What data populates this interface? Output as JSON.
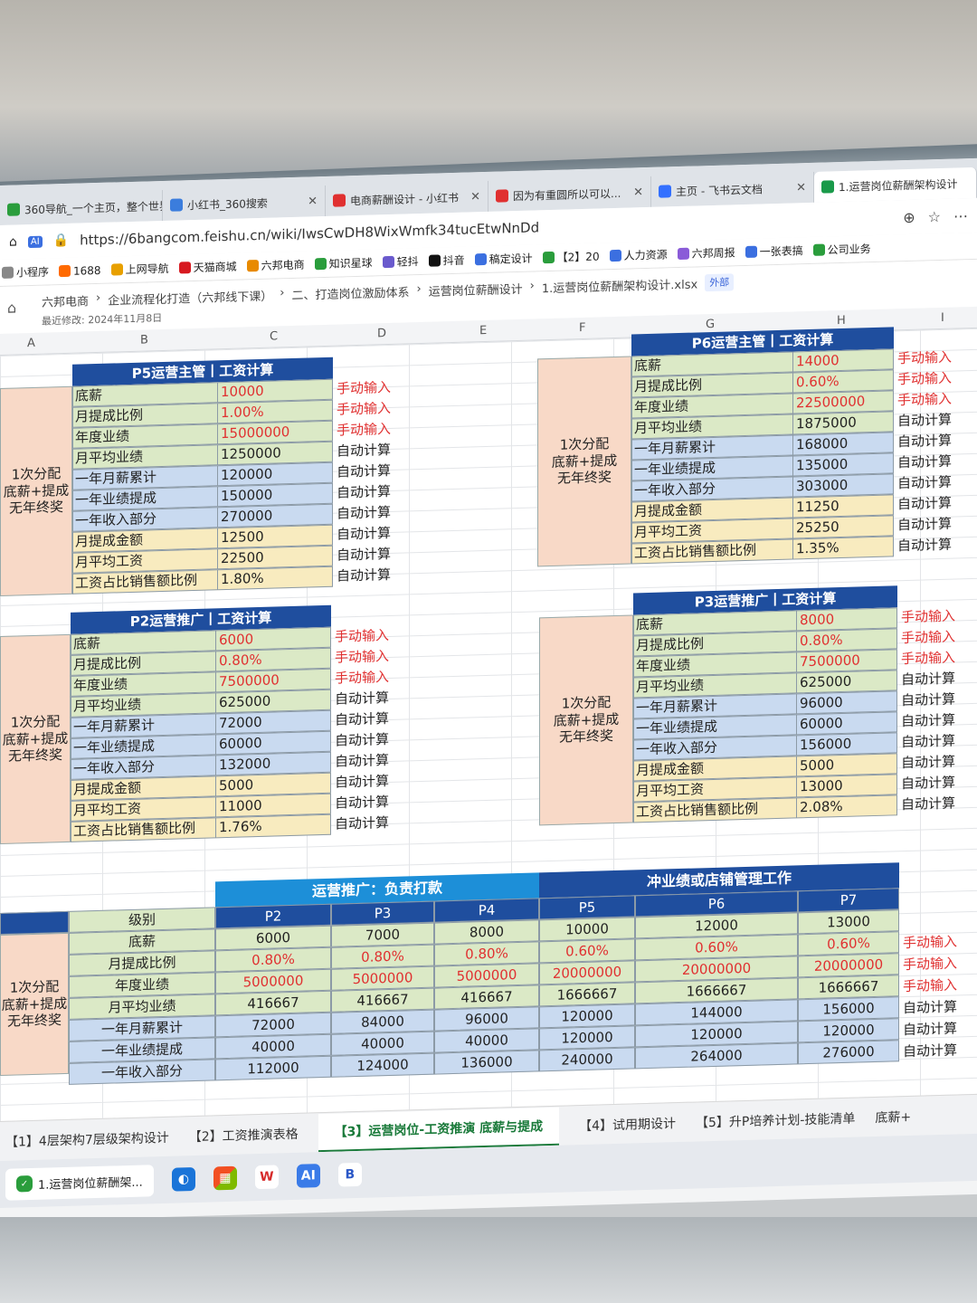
{
  "browser": {
    "tabs": [
      {
        "label": "360导航_一个主页，整个世界",
        "color": "#2a9d3c"
      },
      {
        "label": "小红书_360搜索",
        "color": "#3b7ddd"
      },
      {
        "label": "电商薪酬设计 - 小红书",
        "color": "#e03030"
      },
      {
        "label": "因为有重圆所以可以...",
        "color": "#e03030"
      },
      {
        "label": "主页 - 飞书云文档",
        "color": "#3370ff"
      },
      {
        "label": "1.运营岗位薪酬架构设计",
        "color": "#1a9a4a"
      }
    ],
    "url": "https://6bangcom.feishu.cn/wiki/IwsCwDH8WixWmfk34tucEtwNnDd",
    "bookmarks": [
      "小程序",
      "1688",
      "上网导航",
      "天猫商城",
      "六邦电商",
      "知识星球",
      "轻抖",
      "抖音",
      "稿定设计",
      "【2】20",
      "人力资源",
      "六邦周报",
      "一张表搞",
      "公司业务"
    ]
  },
  "breadcrumb": {
    "items": [
      "六邦电商",
      "企业流程化打造（六邦线下课）",
      "二、打造岗位激励体系",
      "运营岗位薪酬设计",
      "1.运营岗位薪酬架构设计.xlsx"
    ],
    "external": "外部",
    "modified": "最近修改: 2024年11月8日"
  },
  "columns": [
    "A",
    "B",
    "C",
    "D",
    "E",
    "F",
    "G",
    "H",
    "I"
  ],
  "side_label": "1次分配\n底薪+提成\n无年终奖",
  "blocks": {
    "p5": {
      "title": "P5运营主管丨工资计算",
      "rows": [
        {
          "label": "底薪",
          "value": "10000",
          "note": "手动输入"
        },
        {
          "label": "月提成比例",
          "value": "1.00%",
          "note": "手动输入"
        },
        {
          "label": "年度业绩",
          "value": "15000000",
          "note": "手动输入"
        },
        {
          "label": "月平均业绩",
          "value": "1250000",
          "note": "自动计算"
        },
        {
          "label": "一年月薪累计",
          "value": "120000",
          "note": "自动计算"
        },
        {
          "label": "一年业绩提成",
          "value": "150000",
          "note": "自动计算"
        },
        {
          "label": "一年收入部分",
          "value": "270000",
          "note": "自动计算"
        },
        {
          "label": "月提成金额",
          "value": "12500",
          "note": "自动计算"
        },
        {
          "label": "月平均工资",
          "value": "22500",
          "note": "自动计算"
        },
        {
          "label": "工资占比销售额比例",
          "value": "1.80%",
          "note": "自动计算"
        }
      ]
    },
    "p6": {
      "title": "P6运营主管丨工资计算",
      "rows": [
        {
          "label": "底薪",
          "value": "14000",
          "note": "手动输入"
        },
        {
          "label": "月提成比例",
          "value": "0.60%",
          "note": "手动输入"
        },
        {
          "label": "年度业绩",
          "value": "22500000",
          "note": "手动输入"
        },
        {
          "label": "月平均业绩",
          "value": "1875000",
          "note": "自动计算"
        },
        {
          "label": "一年月薪累计",
          "value": "168000",
          "note": "自动计算"
        },
        {
          "label": "一年业绩提成",
          "value": "135000",
          "note": "自动计算"
        },
        {
          "label": "一年收入部分",
          "value": "303000",
          "note": "自动计算"
        },
        {
          "label": "月提成金额",
          "value": "11250",
          "note": "自动计算"
        },
        {
          "label": "月平均工资",
          "value": "25250",
          "note": "自动计算"
        },
        {
          "label": "工资占比销售额比例",
          "value": "1.35%",
          "note": "自动计算"
        }
      ]
    },
    "p2": {
      "title": "P2运营推广丨工资计算",
      "rows": [
        {
          "label": "底薪",
          "value": "6000",
          "note": "手动输入"
        },
        {
          "label": "月提成比例",
          "value": "0.80%",
          "note": "手动输入"
        },
        {
          "label": "年度业绩",
          "value": "7500000",
          "note": "手动输入"
        },
        {
          "label": "月平均业绩",
          "value": "625000",
          "note": "自动计算"
        },
        {
          "label": "一年月薪累计",
          "value": "72000",
          "note": "自动计算"
        },
        {
          "label": "一年业绩提成",
          "value": "60000",
          "note": "自动计算"
        },
        {
          "label": "一年收入部分",
          "value": "132000",
          "note": "自动计算"
        },
        {
          "label": "月提成金额",
          "value": "5000",
          "note": "自动计算"
        },
        {
          "label": "月平均工资",
          "value": "11000",
          "note": "自动计算"
        },
        {
          "label": "工资占比销售额比例",
          "value": "1.76%",
          "note": "自动计算"
        }
      ]
    },
    "p3": {
      "title": "P3运营推广丨工资计算",
      "rows": [
        {
          "label": "底薪",
          "value": "8000",
          "note": "手动输入"
        },
        {
          "label": "月提成比例",
          "value": "0.80%",
          "note": "手动输入"
        },
        {
          "label": "年度业绩",
          "value": "7500000",
          "note": "手动输入"
        },
        {
          "label": "月平均业绩",
          "value": "625000",
          "note": "自动计算"
        },
        {
          "label": "一年月薪累计",
          "value": "96000",
          "note": "自动计算"
        },
        {
          "label": "一年业绩提成",
          "value": "60000",
          "note": "自动计算"
        },
        {
          "label": "一年收入部分",
          "value": "156000",
          "note": "自动计算"
        },
        {
          "label": "月提成金额",
          "value": "5000",
          "note": "自动计算"
        },
        {
          "label": "月平均工资",
          "value": "13000",
          "note": "自动计算"
        },
        {
          "label": "工资占比销售额比例",
          "value": "2.08%",
          "note": "自动计算"
        }
      ]
    }
  },
  "summary": {
    "group1": "运营推广：负责打款",
    "group2": "冲业绩或店铺管理工作",
    "level_header": "级别",
    "levels": [
      "P2",
      "P3",
      "P4",
      "P5",
      "P6",
      "P7"
    ],
    "rows": [
      {
        "label": "底薪",
        "values": [
          "6000",
          "7000",
          "8000",
          "10000",
          "12000",
          "13000"
        ],
        "note": ""
      },
      {
        "label": "月提成比例",
        "values": [
          "0.80%",
          "0.80%",
          "0.80%",
          "0.60%",
          "0.60%",
          "0.60%"
        ],
        "note": "手动输入"
      },
      {
        "label": "年度业绩",
        "values": [
          "5000000",
          "5000000",
          "5000000",
          "20000000",
          "20000000",
          "20000000"
        ],
        "note": "手动输入"
      },
      {
        "label": "月平均业绩",
        "values": [
          "416667",
          "416667",
          "416667",
          "1666667",
          "1666667",
          "1666667"
        ],
        "note": "手动输入"
      },
      {
        "label": "一年月薪累计",
        "values": [
          "72000",
          "84000",
          "96000",
          "120000",
          "144000",
          "156000"
        ],
        "note": "自动计算"
      },
      {
        "label": "一年业绩提成",
        "values": [
          "40000",
          "40000",
          "40000",
          "120000",
          "120000",
          "120000"
        ],
        "note": "自动计算"
      },
      {
        "label": "一年收入部分",
        "values": [
          "112000",
          "124000",
          "136000",
          "240000",
          "264000",
          "276000"
        ],
        "note": "自动计算"
      }
    ],
    "trailing_note": "自动计算"
  },
  "sheet_tabs": [
    "【1】4层架构7层级架构设计",
    "【2】工资推演表格",
    "【3】运营岗位-工资推演 底薪与提成",
    "【4】试用期设计",
    "【5】升P培养计划-技能清单",
    "底薪+"
  ],
  "taskbar": {
    "active_app": "1.运营岗位薪酬架..."
  },
  "colors": {
    "header_blue": "#1f4e9e",
    "summary_blue": "#1d8fd8",
    "side_peach": "#f8d9c7",
    "red_text": "#e03030"
  }
}
